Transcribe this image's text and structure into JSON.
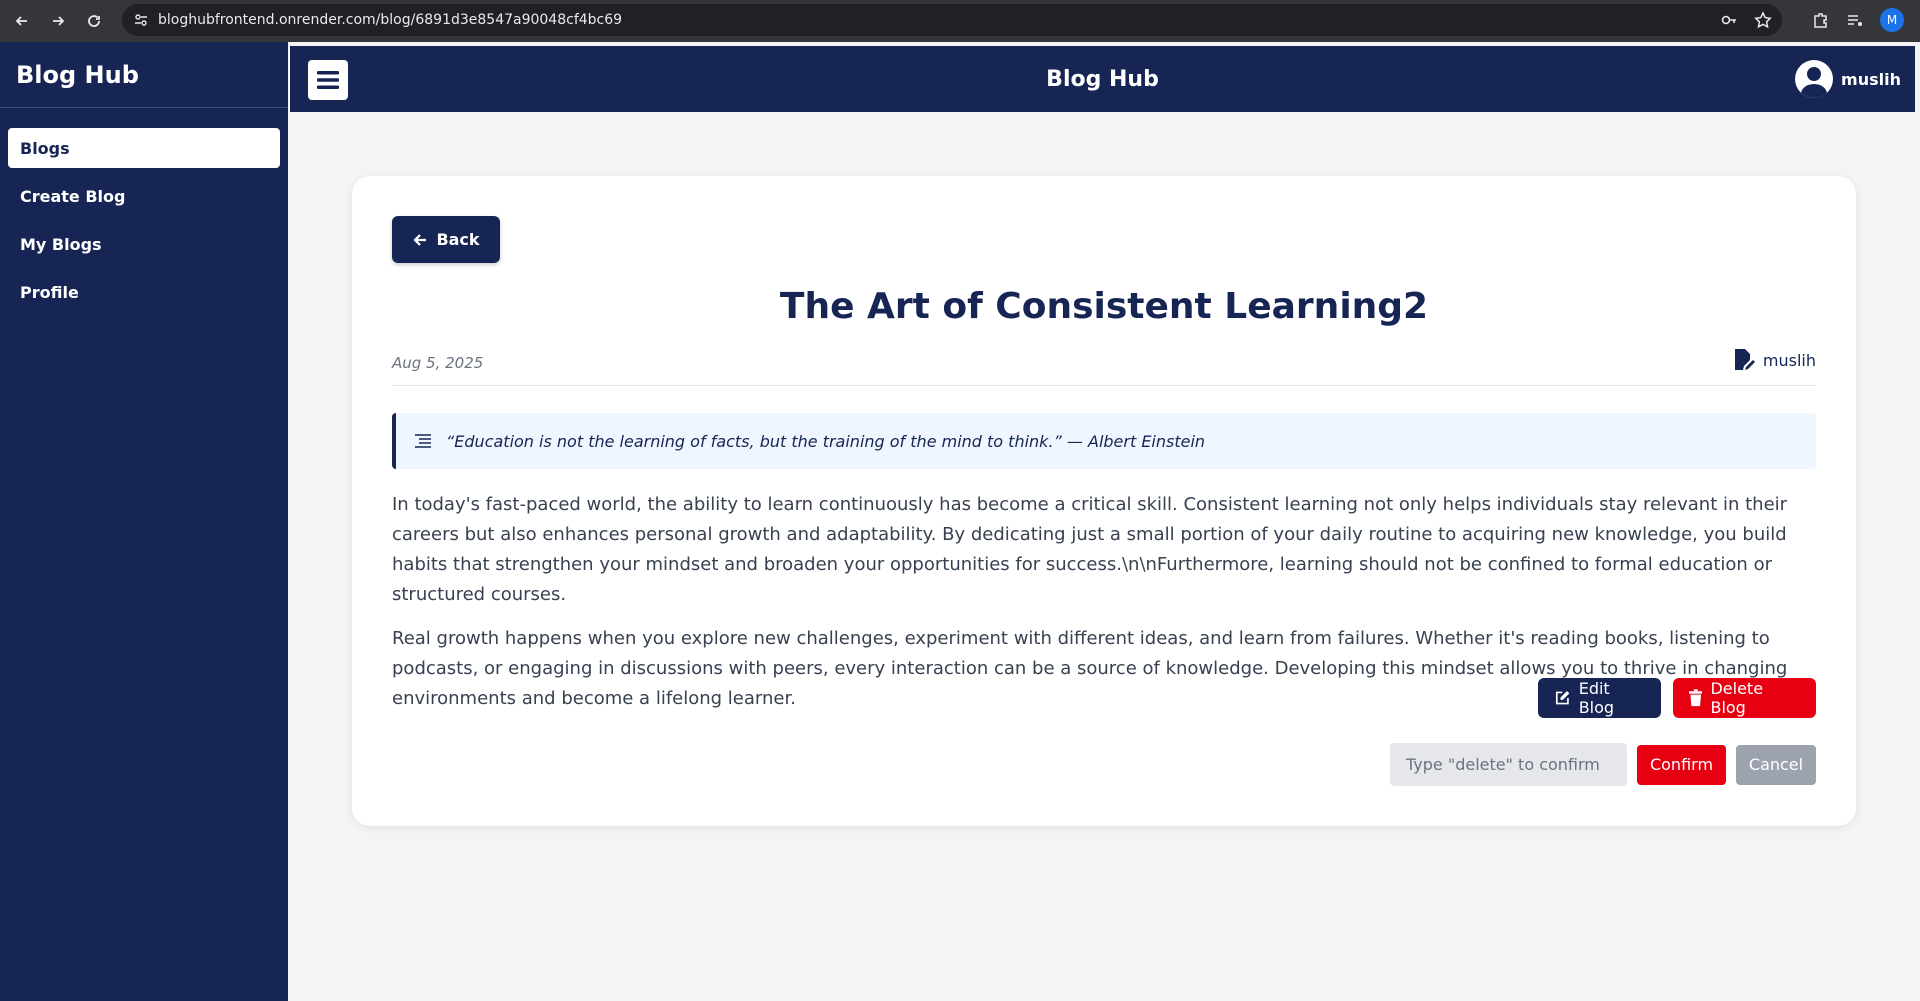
{
  "browser": {
    "url": "bloghubfrontend.onrender.com/blog/6891d3e8547a90048cf4bc69",
    "profile_initial": "M"
  },
  "sidebar": {
    "brand": "Blog Hub",
    "items": [
      {
        "label": "Blogs",
        "active": true
      },
      {
        "label": "Create Blog",
        "active": false
      },
      {
        "label": "My Blogs",
        "active": false
      },
      {
        "label": "Profile",
        "active": false
      }
    ]
  },
  "header": {
    "title": "Blog Hub",
    "username": "muslih"
  },
  "post": {
    "back_label": "Back",
    "title": "The Art of Consistent Learning2",
    "date": "Aug 5, 2025",
    "author": "muslih",
    "quote": "“Education is not the learning of facts, but the training of the mind to think.” — Albert Einstein",
    "paragraphs": [
      "In today's fast-paced world, the ability to learn continuously has become a critical skill. Consistent learning not only helps individuals stay relevant in their careers but also enhances personal growth and adaptability. By dedicating just a small portion of your daily routine to acquiring new knowledge, you build habits that strengthen your mindset and broaden your opportunities for success.\\n\\nFurthermore, learning should not be confined to formal education or structured courses.",
      "Real growth happens when you explore new challenges, experiment with different ideas, and learn from failures. Whether it's reading books, listening to podcasts, or engaging in discussions with peers, every interaction can be a source of knowledge. Developing this mindset allows you to thrive in changing environments and become a lifelong learner."
    ],
    "edit_label": "Edit Blog",
    "delete_label": "Delete Blog",
    "confirm_placeholder": "Type \"delete\" to confirm",
    "confirm_label": "Confirm",
    "cancel_label": "Cancel"
  },
  "colors": {
    "navy": "#172554",
    "danger": "#e60012",
    "muted": "#9ca3af"
  }
}
